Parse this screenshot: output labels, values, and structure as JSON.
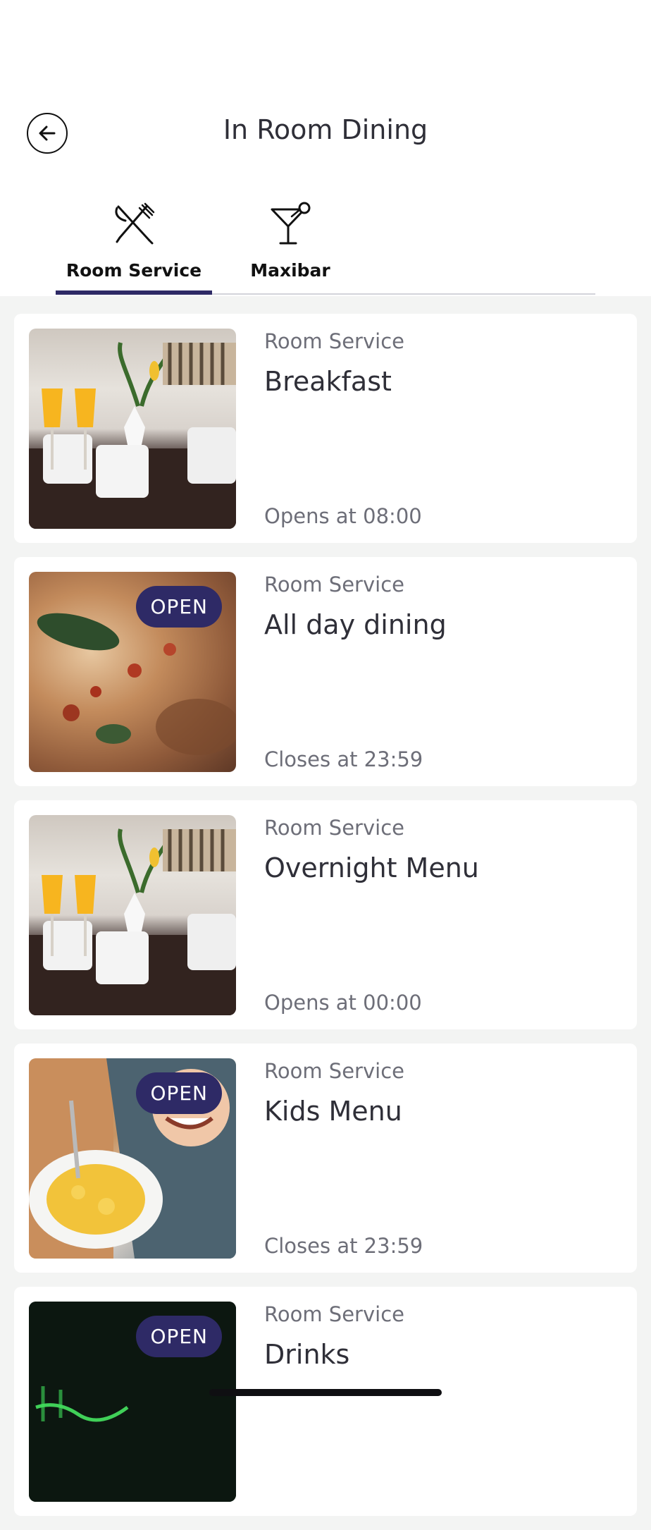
{
  "header": {
    "title": "In Room Dining"
  },
  "tabs": [
    {
      "label": "Room Service",
      "icon": "fork-knife-icon"
    },
    {
      "label": "Maxibar",
      "icon": "cocktail-glass-icon"
    }
  ],
  "cards": [
    {
      "category": "Room Service",
      "title": "Breakfast",
      "status": "Opens at 08:00",
      "badge": ""
    },
    {
      "category": "Room Service",
      "title": "All day dining",
      "status": "Closes at 23:59",
      "badge": "OPEN"
    },
    {
      "category": "Room Service",
      "title": "Overnight Menu",
      "status": "Opens at 00:00",
      "badge": ""
    },
    {
      "category": "Room Service",
      "title": "Kids Menu",
      "status": "Closes at 23:59",
      "badge": "OPEN"
    },
    {
      "category": "Room Service",
      "title": "Drinks",
      "status": "",
      "badge": "OPEN"
    }
  ],
  "colors": {
    "accent": "#2e2a66",
    "background": "#f3f4f3"
  }
}
